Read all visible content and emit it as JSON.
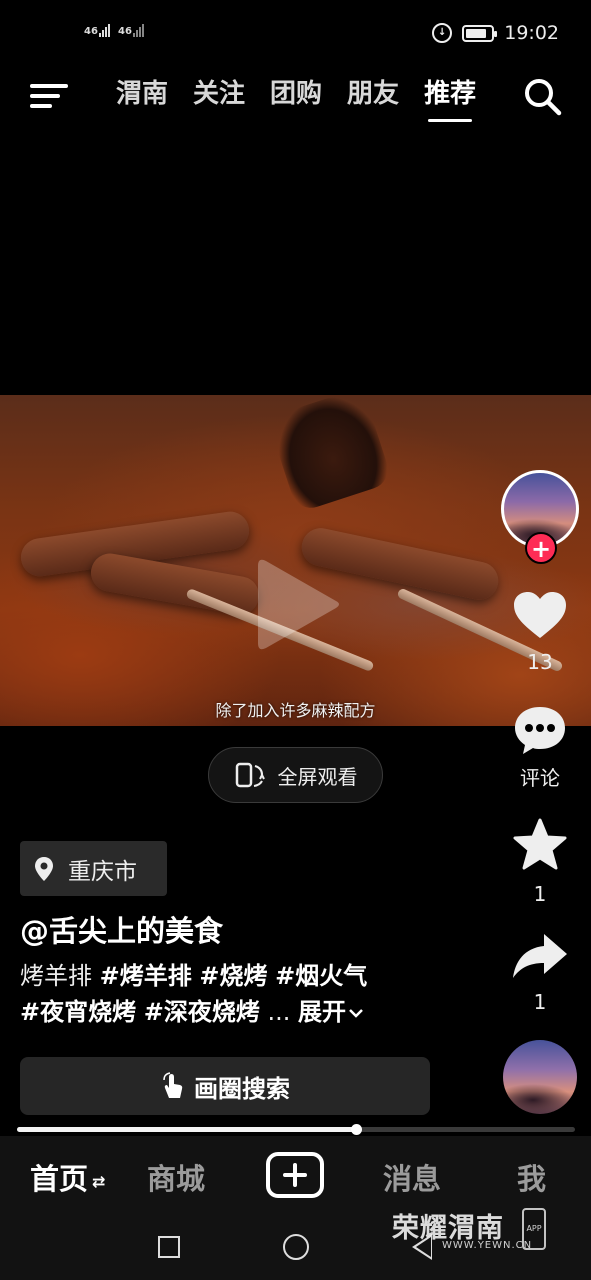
{
  "status_bar": {
    "sim1": "46",
    "sim2": "46",
    "time": "19:02"
  },
  "top_nav": {
    "tabs": [
      {
        "label": "渭南",
        "active": false
      },
      {
        "label": "关注",
        "active": false
      },
      {
        "label": "团购",
        "active": false
      },
      {
        "label": "朋友",
        "active": false
      },
      {
        "label": "推荐",
        "active": true
      }
    ]
  },
  "video": {
    "subtitle": "除了加入许多麻辣配方",
    "fullscreen_label": "全屏观看"
  },
  "rail": {
    "likes": "13",
    "comments_label": "评论",
    "favorites": "1",
    "shares": "1"
  },
  "post": {
    "location": "重庆市",
    "author": "@舌尖上的美食",
    "desc_plain": "烤羊排",
    "tags": [
      "#烤羊排",
      "#烧烤",
      "#烟火气",
      "#夜宵烧烤",
      "#深夜烧烤"
    ],
    "ellipsis": "...",
    "expand_label": "展开",
    "circle_search_label": "画圈搜索"
  },
  "progress": {
    "fraction": 0.607
  },
  "bottom_nav": {
    "home": "首页",
    "mall": "商城",
    "messages": "消息",
    "me": "我"
  },
  "watermark": {
    "title": "荣耀渭南",
    "url": "WWW.YEWN.CN",
    "app": "APP"
  },
  "colors": {
    "accent": "#fe2c55",
    "background": "#000000"
  }
}
